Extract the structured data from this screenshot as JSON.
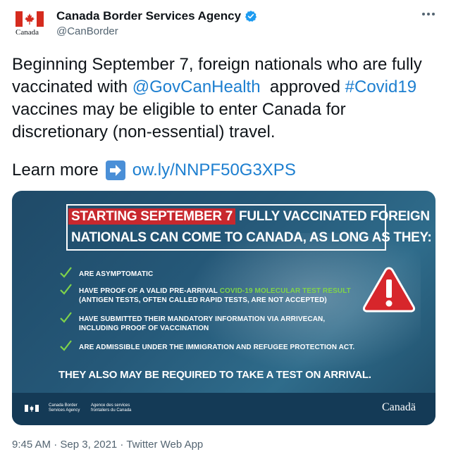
{
  "author": {
    "name": "Canada Border Services Agency",
    "handle": "@CanBorder",
    "logo_wordmark": "Canada",
    "verified_icon": "verified-badge-icon"
  },
  "more_icon": "more-dots-icon",
  "tweet": {
    "line1": "Beginning September 7, foreign nationals who are fully",
    "line2_a": "vaccinated with ",
    "mention": "@GovCanHealth",
    "line2_b": "  approved ",
    "hashtag": "#Covid19",
    "line3": "vaccines may be eligible to enter Canada for",
    "line4": "discretionary (non-essential) travel.",
    "learn_more": "Learn more",
    "arrow_icon": "right-arrow-emoji-icon",
    "link": "ow.ly/NNPF50G3XPS"
  },
  "media": {
    "headline_red": "STARTING SEPTEMBER 7",
    "headline_rest_1": " FULLY VACCINATED FOREIGN",
    "headline_line2": "NATIONALS CAN COME TO CANADA, AS LONG AS THEY:",
    "items": [
      {
        "text": "ARE ASYMPTOMATIC"
      },
      {
        "text_a": "HAVE PROOF OF A VALID PRE-ARRIVAL ",
        "text_green": "COVID-19 MOLECULAR TEST RESULT",
        "text_b": "(ANTIGEN TESTS, OFTEN CALLED RAPID TESTS, ARE NOT ACCEPTED)"
      },
      {
        "text": "HAVE SUBMITTED THEIR MANDATORY INFORMATION VIA ARRIVECAN,",
        "text_b": "INCLUDING PROOF OF VACCINATION"
      },
      {
        "text": "ARE ADMISSIBLE UNDER THE IMMIGRATION AND REFUGEE PROTECTION ACT."
      }
    ],
    "footer_note": "THEY ALSO MAY BE REQUIRED TO TAKE A TEST ON ARRIVAL.",
    "agency_en": "Canada Border\nServices Agency",
    "agency_fr": "Agence des services\nfrontaliers du Canada",
    "wordmark": "Canadä",
    "check_color": "#7fd34a",
    "warning_color": "#d7262b"
  },
  "meta": {
    "timestamp": "9:45 AM · Sep 3, 2021 · Twitter Web App"
  }
}
